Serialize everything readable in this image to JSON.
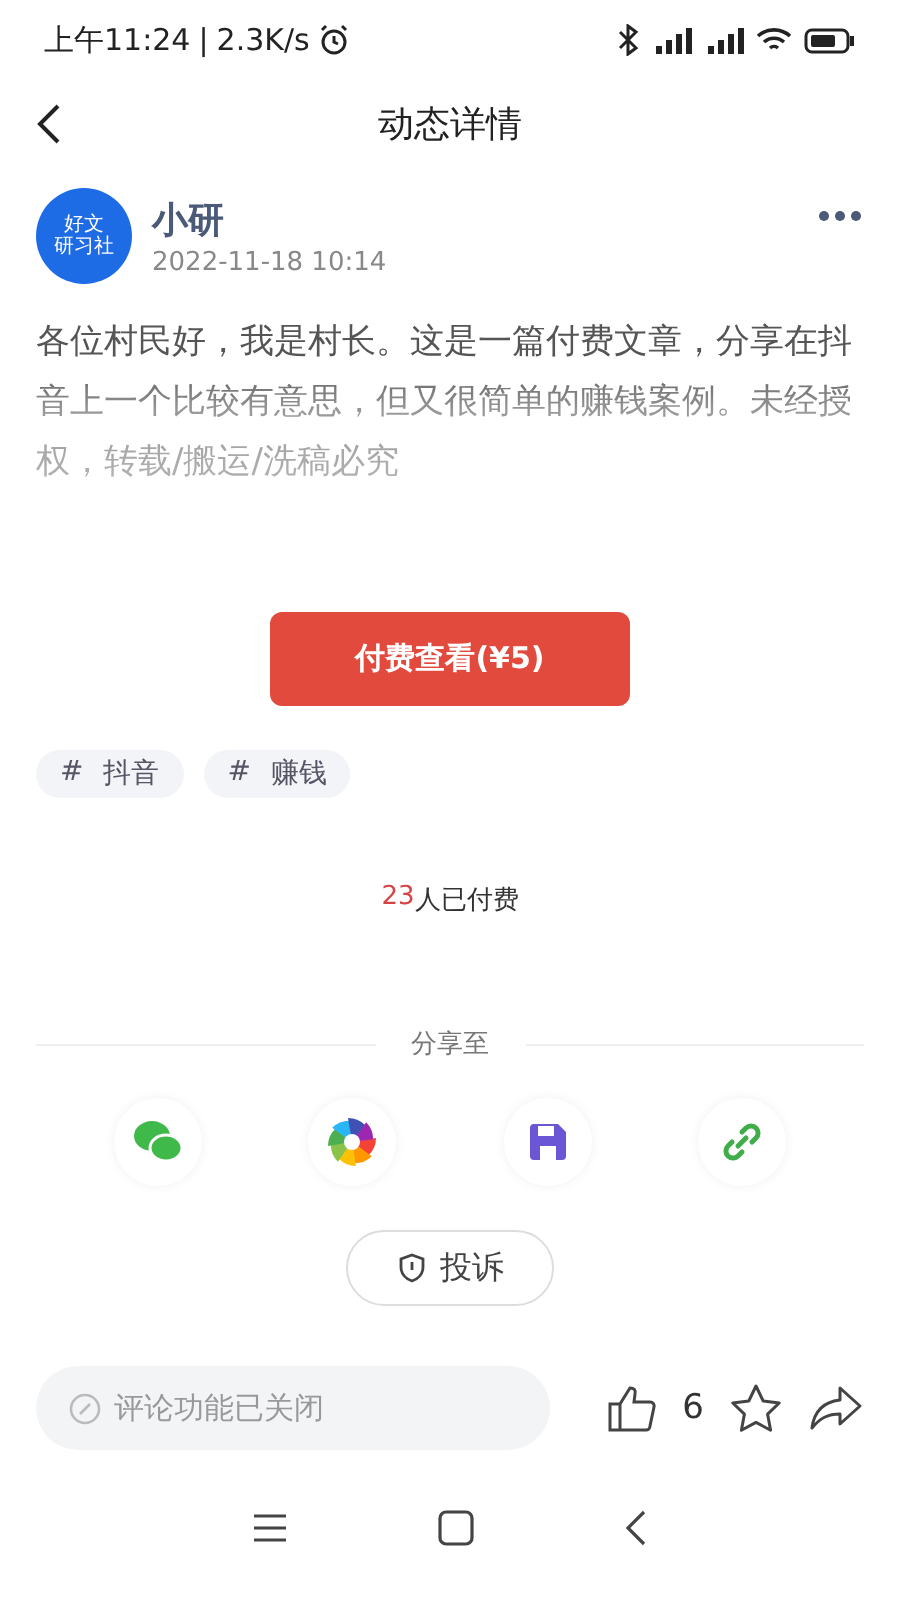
{
  "status_bar": {
    "time": "上午11:24",
    "separator": "|",
    "speed": "2.3K/s"
  },
  "header": {
    "title": "动态详情"
  },
  "author": {
    "avatar_lines": [
      "好文",
      "研习社"
    ],
    "name": "小研",
    "time": "2022-11-18 10:14"
  },
  "article": {
    "text": "各位村民好，我是村长。这是一篇付费文章，分享在抖音上一个比较有意思，但又很简单的赚钱案例。未经授权，转载/搬运/洗稿必究"
  },
  "pay_button": "付费查看(¥5)",
  "tags": [
    {
      "hash": "#",
      "label": "抖音"
    },
    {
      "hash": "#",
      "label": "赚钱"
    }
  ],
  "paid": {
    "count": "23",
    "label": "人已付费"
  },
  "share": {
    "title": "分享至",
    "targets": [
      {
        "kind": "wechat"
      },
      {
        "kind": "moments"
      },
      {
        "kind": "save"
      },
      {
        "kind": "link"
      }
    ]
  },
  "report_button": "投诉",
  "bottom_bar": {
    "comment_placeholder": "评论功能已关闭",
    "likes": "6"
  }
}
